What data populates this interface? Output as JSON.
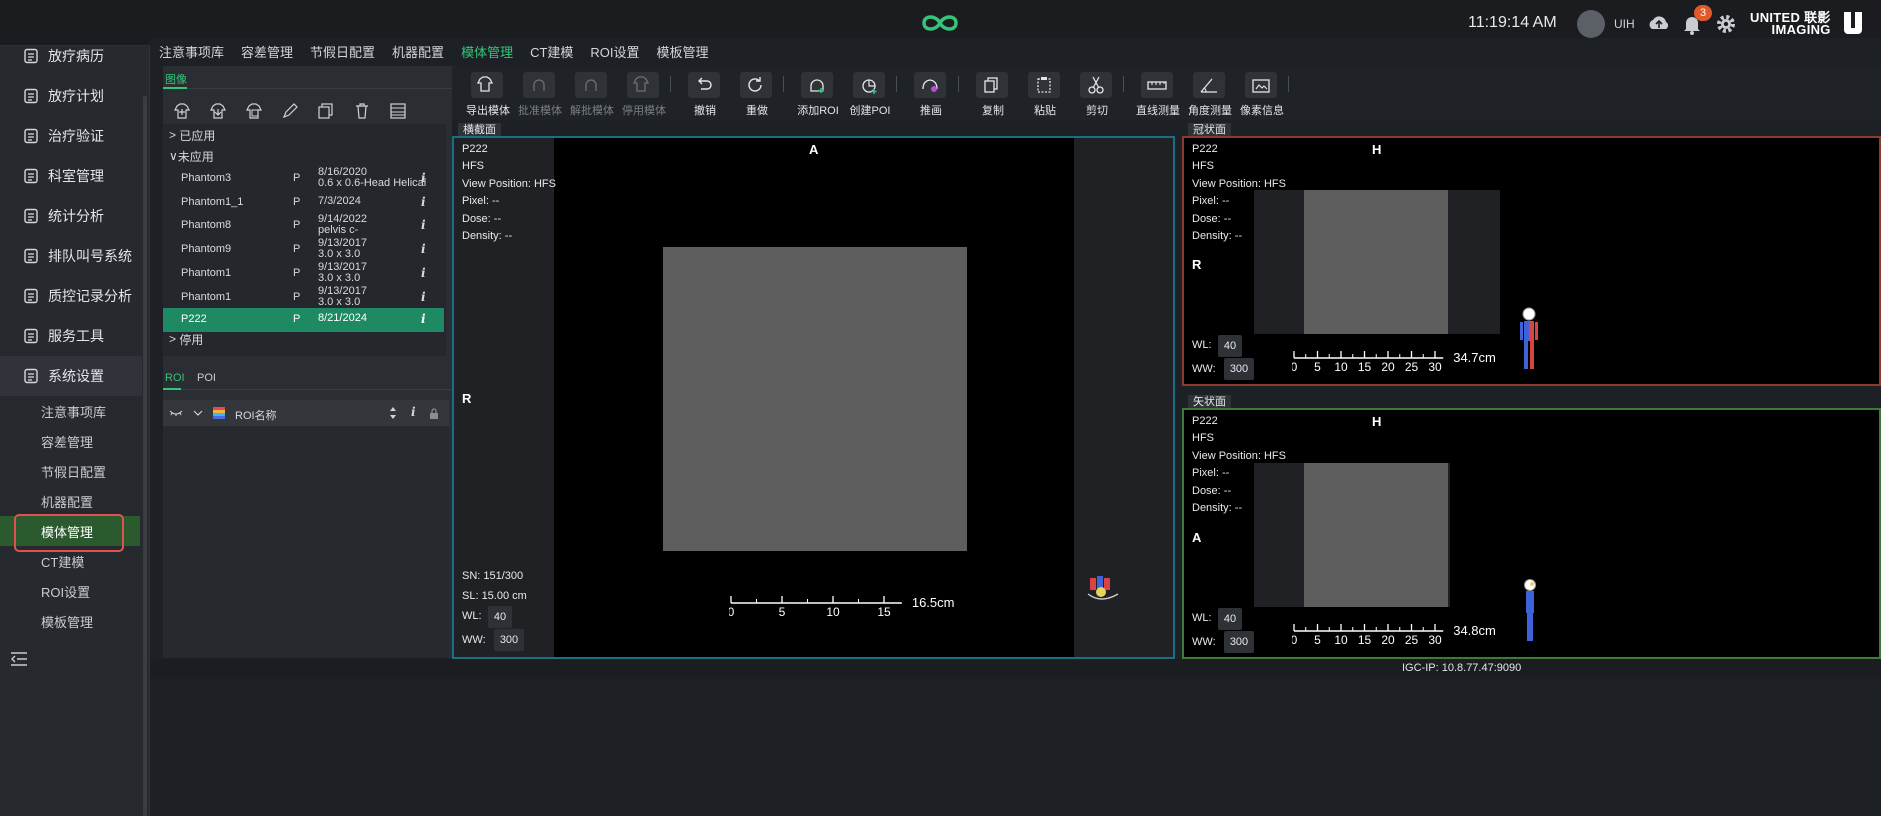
{
  "topbar": {
    "time": "11:19:14 AM",
    "username": "UIH",
    "notification_count": "3",
    "brand_line1": "UNITED 联影",
    "brand_line2": "IMAGING"
  },
  "sidebar": {
    "items": [
      {
        "label": "放疗病历",
        "icon": "clipboard-icon"
      },
      {
        "label": "放疗计划",
        "icon": "plan-icon"
      },
      {
        "label": "治疗验证",
        "icon": "verify-icon"
      },
      {
        "label": "科室管理",
        "icon": "department-icon"
      },
      {
        "label": "统计分析",
        "icon": "chart-icon"
      },
      {
        "label": "排队叫号系统",
        "icon": "queue-icon"
      },
      {
        "label": "质控记录分析",
        "icon": "shield-icon"
      },
      {
        "label": "服务工具",
        "icon": "tools-icon"
      },
      {
        "label": "系统设置",
        "icon": "settings-icon"
      }
    ],
    "sub_items": [
      "注意事项库",
      "容差管理",
      "节假日配置",
      "机器配置",
      "模体管理",
      "CT建模",
      "ROI设置",
      "模板管理"
    ],
    "active_sub": "模体管理"
  },
  "module_tabs": [
    "注意事项库",
    "容差管理",
    "节假日配置",
    "机器配置",
    "模体管理",
    "CT建模",
    "ROI设置",
    "模板管理"
  ],
  "active_module_tab": "模体管理",
  "image_panel": {
    "tab": "图像",
    "groups": {
      "applied": "已应用",
      "unapplied": "未应用",
      "disabled": "停用"
    },
    "rows": [
      {
        "name": "Phantom3",
        "p": "P",
        "date": "8/16/2020",
        "desc": "0.6 x 0.6-Head Helical"
      },
      {
        "name": "Phantom1_1",
        "p": "P",
        "date": "7/3/2024",
        "desc": ""
      },
      {
        "name": "Phantom8",
        "p": "P",
        "date": "9/14/2022",
        "desc": "pelvis c-"
      },
      {
        "name": "Phantom9",
        "p": "P",
        "date": "9/13/2017",
        "desc": "3.0 x 3.0"
      },
      {
        "name": "Phantom1",
        "p": "P",
        "date": "9/13/2017",
        "desc": "3.0 x 3.0"
      },
      {
        "name": "Phantom1",
        "p": "P",
        "date": "9/13/2017",
        "desc": "3.0 x 3.0"
      },
      {
        "name": "P222",
        "p": "P",
        "date": "8/21/2024",
        "desc": ""
      }
    ],
    "info_glyph": "i"
  },
  "roi_panel": {
    "tabs": [
      "ROI",
      "POI"
    ],
    "column_name": "ROI名称",
    "info_glyph": "i"
  },
  "toolbar": {
    "buttons": [
      {
        "label": "导出模体",
        "icon": "export-phantom-icon",
        "enabled": true
      },
      {
        "label": "批准模体",
        "icon": "approve-phantom-icon",
        "enabled": false
      },
      {
        "label": "解批模体",
        "icon": "unapprove-phantom-icon",
        "enabled": false
      },
      {
        "label": "停用模体",
        "icon": "disable-phantom-icon",
        "enabled": false
      },
      {
        "label": "撤销",
        "icon": "undo-icon",
        "enabled": true
      },
      {
        "label": "重做",
        "icon": "redo-icon",
        "enabled": true
      },
      {
        "label": "添加ROI",
        "icon": "add-roi-icon",
        "enabled": true
      },
      {
        "label": "创建POI",
        "icon": "create-poi-icon",
        "enabled": true
      },
      {
        "label": "推画",
        "icon": "push-draw-icon",
        "enabled": true
      },
      {
        "label": "复制",
        "icon": "copy-icon",
        "enabled": true
      },
      {
        "label": "粘贴",
        "icon": "paste-icon",
        "enabled": true
      },
      {
        "label": "剪切",
        "icon": "cut-icon",
        "enabled": true
      },
      {
        "label": "直线测量",
        "icon": "ruler-icon",
        "enabled": true
      },
      {
        "label": "角度测量",
        "icon": "angle-icon",
        "enabled": true
      },
      {
        "label": "像素信息",
        "icon": "pixel-info-icon",
        "enabled": true
      }
    ]
  },
  "viewers": {
    "axial": {
      "label": "横截面",
      "patient": "P222",
      "orientation": "HFS",
      "view_position": "View Position: HFS",
      "pixel": "Pixel:  --",
      "dose": "Dose:  --",
      "density": "Density:  --",
      "top_marker": "A",
      "left_marker": "R",
      "sn": "SN: 151/300",
      "sl": "SL: 15.00 cm",
      "wl_label": "WL:",
      "wl": "40",
      "ww_label": "WW:",
      "ww": "300",
      "scale_ticks": [
        "0",
        "5",
        "10",
        "15"
      ],
      "scale_text": "16.5cm"
    },
    "coronal": {
      "label": "冠状面",
      "patient": "P222",
      "orientation": "HFS",
      "view_position": "View Position: HFS",
      "pixel": "Pixel:  --",
      "dose": "Dose:  --",
      "density": "Density:  --",
      "top_marker": "H",
      "left_marker": "R",
      "wl_label": "WL:",
      "wl": "40",
      "ww_label": "WW:",
      "ww": "300",
      "scale_ticks": [
        "0",
        "5",
        "10",
        "15",
        "20",
        "25",
        "30"
      ],
      "scale_text": "34.7cm"
    },
    "sagittal": {
      "label": "矢状面",
      "patient": "P222",
      "orientation": "HFS",
      "view_position": "View Position: HFS",
      "pixel": "Pixel:  --",
      "dose": "Dose:  --",
      "density": "Density:  --",
      "top_marker": "H",
      "left_marker": "A",
      "wl_label": "WL:",
      "wl": "40",
      "ww_label": "WW:",
      "ww": "300",
      "scale_ticks": [
        "0",
        "5",
        "10",
        "15",
        "20",
        "25",
        "30"
      ],
      "scale_text": "34.8cm"
    }
  },
  "status": {
    "ip": "IGC-IP: 10.8.77.47:9090"
  },
  "colors": {
    "accent": "#35c47a",
    "selected_row": "#1e8a63",
    "active_nav": "#2b5a2e",
    "highlight": "#e05252"
  }
}
